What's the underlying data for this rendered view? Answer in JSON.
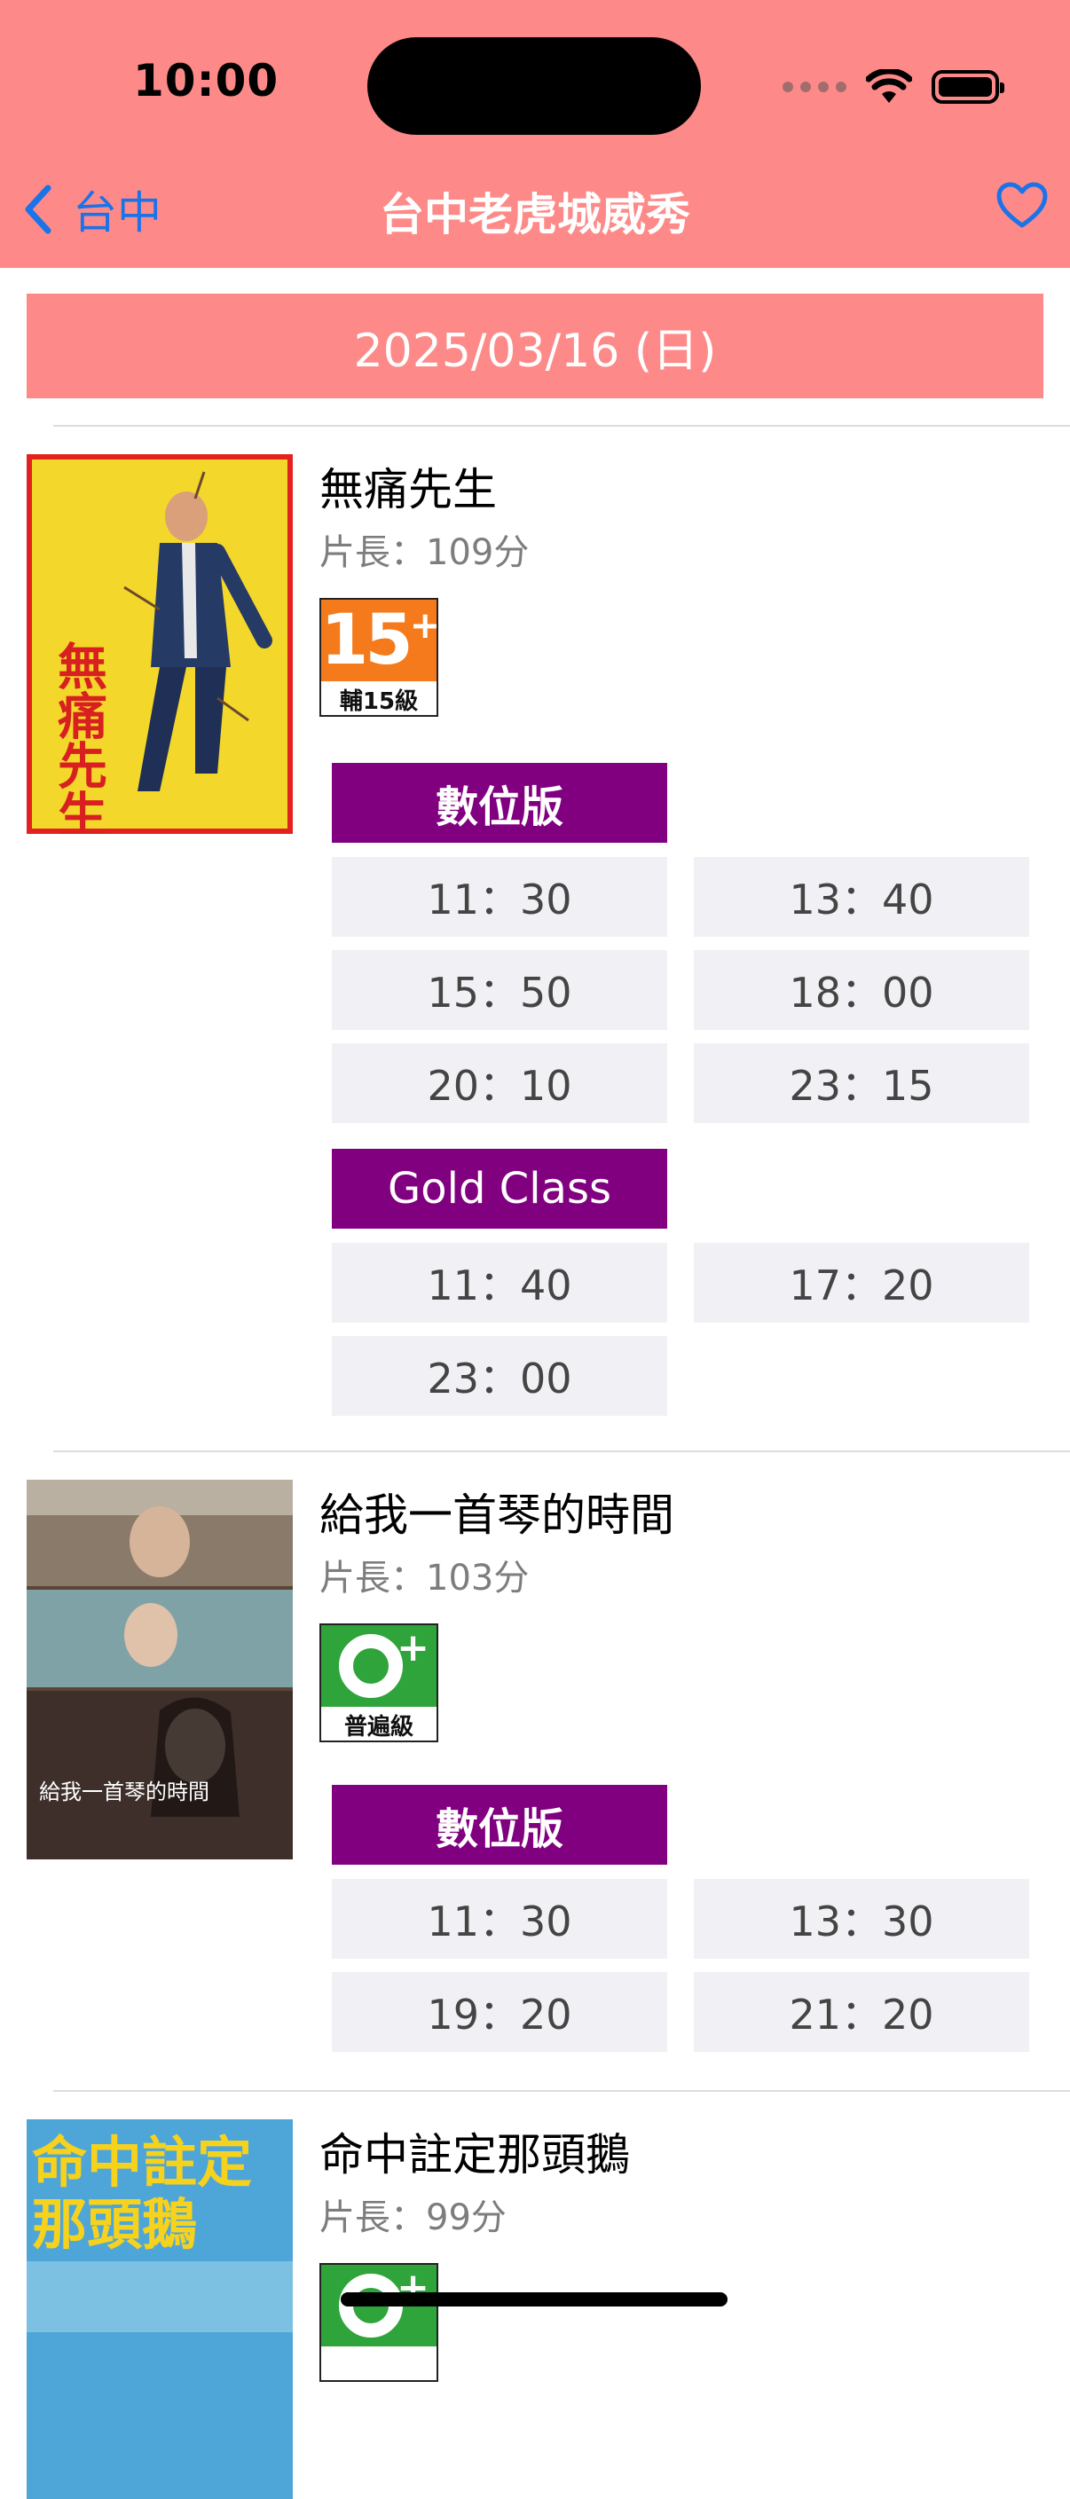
{
  "status_bar": {
    "time": "10:00"
  },
  "nav": {
    "back_label": "台中",
    "title": "台中老虎城威秀"
  },
  "date": "2025/03/16 (日)",
  "movies": [
    {
      "title": "無痛先生",
      "length": "片長：109分",
      "rating": {
        "mark": "15",
        "label": "輔15級"
      },
      "poster_text": "無痛先生",
      "formats": [
        {
          "name": "數位版",
          "times": [
            "11：30",
            "13：40",
            "15：50",
            "18：00",
            "20：10",
            "23：15"
          ]
        },
        {
          "name": "Gold Class",
          "times": [
            "11：40",
            "17：20",
            "23：00"
          ]
        }
      ]
    },
    {
      "title": "給我一首琴的時間",
      "length": "片長：103分",
      "rating": {
        "mark": "0",
        "label": "普遍級"
      },
      "poster_text": "給我一首琴的時間",
      "formats": [
        {
          "name": "數位版",
          "times": [
            "11：30",
            "13：30",
            "19：20",
            "21：20"
          ]
        }
      ]
    },
    {
      "title": "命中註定那頭鵝",
      "length": "片長：99分",
      "poster_text": "命中註定那頭鵝"
    }
  ]
}
